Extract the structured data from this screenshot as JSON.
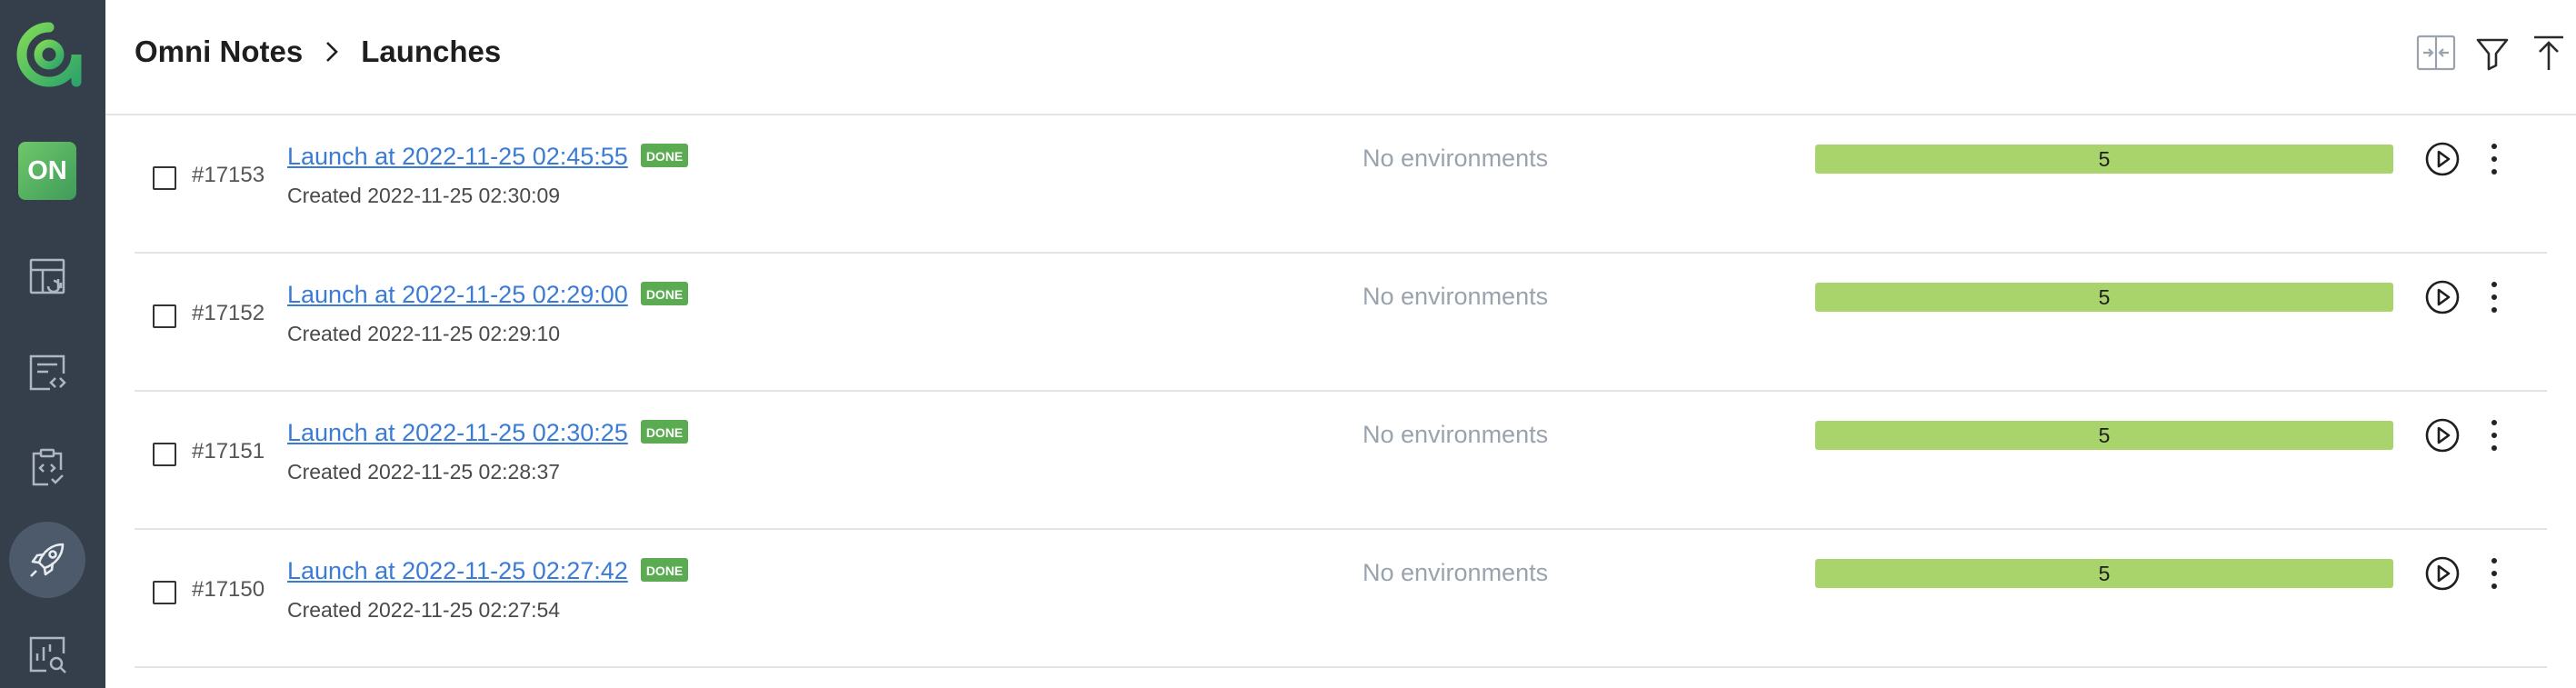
{
  "sidebar": {
    "logo_icon": "allure-logo-icon",
    "project_badge": "ON",
    "nav": [
      {
        "icon": "dashboard-icon"
      },
      {
        "icon": "test-cases-icon"
      },
      {
        "icon": "test-plans-icon"
      },
      {
        "icon": "launches-rocket-icon",
        "active": true
      },
      {
        "icon": "analytics-search-icon"
      }
    ]
  },
  "header": {
    "breadcrumb": {
      "project": "Omni Notes",
      "page": "Launches"
    },
    "actions": [
      "compare-icon",
      "filter-icon",
      "upload-icon"
    ]
  },
  "launches": [
    {
      "id": "#17153",
      "name": "Launch at 2022-11-25 02:45:55",
      "status": "DONE",
      "created": "Created 2022-11-25 02:30:09",
      "env": "No environments",
      "count": "5"
    },
    {
      "id": "#17152",
      "name": "Launch at 2022-11-25 02:29:00",
      "status": "DONE",
      "created": "Created 2022-11-25 02:29:10",
      "env": "No environments",
      "count": "5"
    },
    {
      "id": "#17151",
      "name": "Launch at 2022-11-25 02:30:25",
      "status": "DONE",
      "created": "Created 2022-11-25 02:28:37",
      "env": "No environments",
      "count": "5"
    },
    {
      "id": "#17150",
      "name": "Launch at 2022-11-25 02:27:42",
      "status": "DONE",
      "created": "Created 2022-11-25 02:27:54",
      "env": "No environments",
      "count": "5"
    }
  ],
  "colors": {
    "sidebar": "#353f4b",
    "link": "#3a7bd5",
    "status_done": "#5aab51",
    "result_bar": "#a9d36b"
  }
}
